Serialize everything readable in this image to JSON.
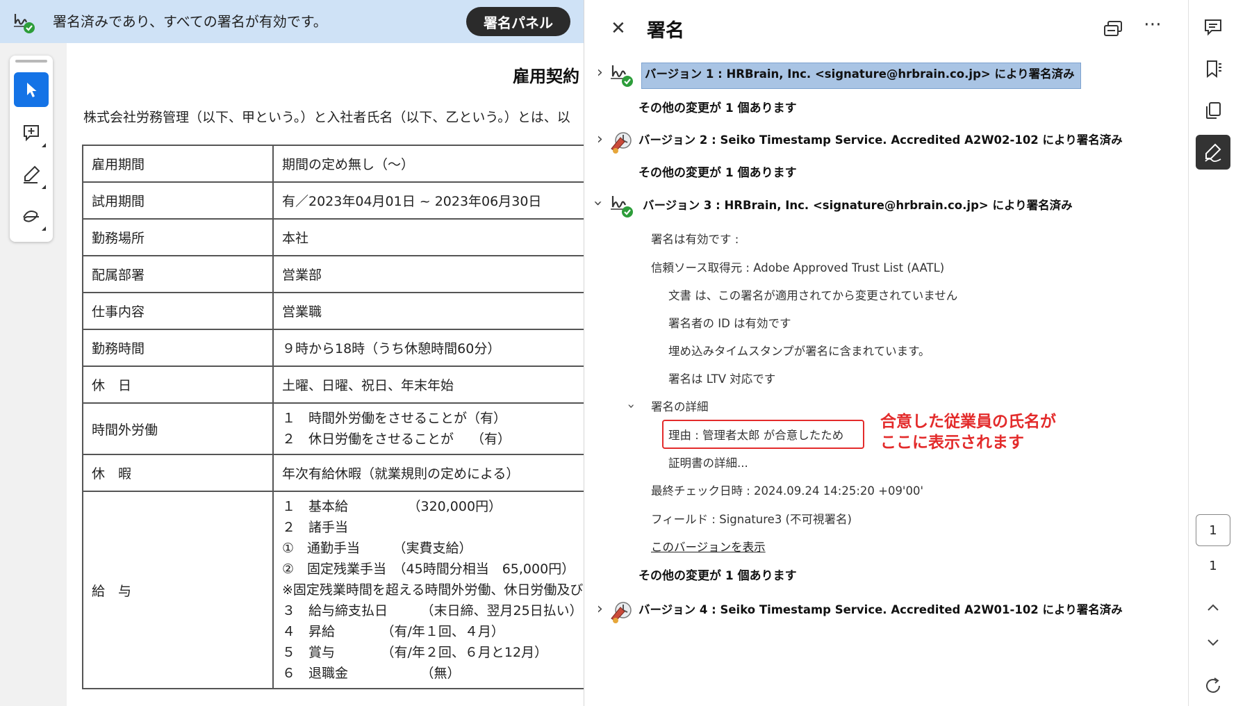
{
  "banner": {
    "message": "署名済みであり、すべての署名が有効です。",
    "button_label": "署名パネル"
  },
  "tools": [
    {
      "icon": "cursor-icon",
      "active": true
    },
    {
      "icon": "add-comment-icon",
      "active": false
    },
    {
      "icon": "highlight-pen-icon",
      "active": false
    },
    {
      "icon": "freehand-draw-icon",
      "active": false
    }
  ],
  "document": {
    "title": "雇用契約",
    "intro": "株式会社労務管理（以下、甲という。）と入社者氏名（以下、乙という。）とは、以",
    "rows": [
      {
        "label": "雇用期間",
        "lines": [
          "期間の定め無し（〜）"
        ]
      },
      {
        "label": "試用期間",
        "lines": [
          "有／2023年04月01日 ~ 2023年06月30日"
        ]
      },
      {
        "label": "勤務場所",
        "lines": [
          "本社"
        ]
      },
      {
        "label": "配属部署",
        "lines": [
          "営業部"
        ]
      },
      {
        "label": "仕事内容",
        "lines": [
          "営業職"
        ]
      },
      {
        "label": "勤務時間",
        "lines": [
          "９時から18時（うち休憩時間60分）"
        ]
      },
      {
        "label": "休　日",
        "lines": [
          "土曜、日曜、祝日、年末年始"
        ]
      },
      {
        "label": "時間外労働",
        "lines": [
          "１　時間外労働をさせることが（有）",
          "２　休日労働をさせることが　 （有）"
        ]
      },
      {
        "label": "休　暇",
        "lines": [
          "年次有給休暇（就業規則の定めによる）"
        ]
      },
      {
        "label": "給　与",
        "lines": [
          "１　基本給　　　　　（320,000円）",
          "２　諸手当",
          "①　通勤手当　　　（実費支給）",
          "②　固定残業手当　（45時間分相当　65,000円）",
          "※固定残業時間を超える時間外労働、休日労働及び",
          "３　給与締支払日　　　（末日締、翌月25日払い）",
          "４　昇給　　　　（有/年１回、４月）",
          "５　賞与　　　　（有/年２回、６月と12月）",
          "６　退職金　　　　　　（無）"
        ]
      }
    ]
  },
  "panel": {
    "title": "署名",
    "close_icon": "close-icon",
    "versions": [
      {
        "label": "バージョン 1 : HRBrain, Inc. <signature@hrbrain.co.jp> により署名済み",
        "other": "その他の変更が 1 個あります",
        "icon": "signature-valid-icon"
      },
      {
        "label": "バージョン 2 : Seiko Timestamp Service. Accredited A2W02-102 により署名済み",
        "other": "その他の変更が 1 個あります",
        "icon": "timestamp-icon"
      },
      {
        "label": "バージョン 3 : HRBrain, Inc. <signature@hrbrain.co.jp> により署名済み",
        "other": "その他の変更が 1 個あります",
        "icon": "signature-valid-icon"
      },
      {
        "label": "バージョン 4 : Seiko Timestamp Service. Accredited A2W01-102 により署名済み",
        "icon": "timestamp-icon"
      }
    ],
    "details": {
      "valid": "署名は有効です :",
      "trust_source": "信頼ソース取得元 : Adobe Approved Trust List (AATL)",
      "unchanged": "文書 は、この署名が適用されてから変更されていません",
      "signer_id": "署名者の ID は有効です",
      "timestamp_embedded": "埋め込みタイムスタンプが署名に含まれています。",
      "ltv": "署名は LTV 対応です",
      "details_header": "署名の詳細",
      "reason": "理由 : 管理者太郎 が合意したため",
      "cert_details": "証明書の詳細...",
      "last_checked": "最終チェック日時 : 2024.09.24 14:25:20 +09'00'",
      "field": "フィールド : Signature3 (不可視署名)",
      "view_version": "このバージョンを表示"
    },
    "annotation": {
      "line1": "合意した従業員の氏名が",
      "line2": "ここに表示されます"
    }
  },
  "rail": {
    "icons": [
      "comment-icon",
      "bookmark-icon",
      "pages-icon",
      "fill-sign-icon"
    ],
    "current_page": "1",
    "total_pages": "1"
  },
  "colors": {
    "banner_bg": "#cfe2f6",
    "accent": "#1473e6",
    "annotation_red": "#e32b2b",
    "selection": "#a9c4e4",
    "valid_green": "#2d9d3a"
  }
}
